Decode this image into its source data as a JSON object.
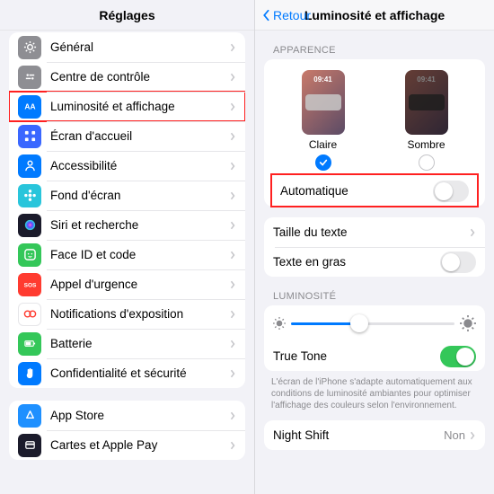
{
  "left": {
    "title": "Réglages",
    "items": [
      {
        "label": "Général",
        "icon": "gear",
        "color": "#8e8e93"
      },
      {
        "label": "Centre de contrôle",
        "icon": "control",
        "color": "#8e8e93"
      },
      {
        "label": "Luminosité et affichage",
        "icon": "aa",
        "color": "#007aff",
        "highlight": true
      },
      {
        "label": "Écran d'accueil",
        "icon": "grid",
        "color": "#3a67ff"
      },
      {
        "label": "Accessibilité",
        "icon": "person",
        "color": "#007aff"
      },
      {
        "label": "Fond d'écran",
        "icon": "flower",
        "color": "#29c5db"
      },
      {
        "label": "Siri et recherche",
        "icon": "siri",
        "color": "#1b1b2b"
      },
      {
        "label": "Face ID et code",
        "icon": "face",
        "color": "#34c759"
      },
      {
        "label": "Appel d'urgence",
        "icon": "sos",
        "color": "#ff3b30"
      },
      {
        "label": "Notifications d'exposition",
        "icon": "exposure",
        "color": "#ffffff",
        "border": true
      },
      {
        "label": "Batterie",
        "icon": "battery",
        "color": "#34c759"
      },
      {
        "label": "Confidentialité et sécurité",
        "icon": "hand",
        "color": "#007aff"
      }
    ],
    "items2": [
      {
        "label": "App Store",
        "icon": "appstore",
        "color": "#1e90ff"
      },
      {
        "label": "Cartes et Apple Pay",
        "icon": "wallet",
        "color": "#1b1b2b"
      }
    ]
  },
  "right": {
    "back": "Retour",
    "title": "Luminosité et affichage",
    "appearance_header": "APPARENCE",
    "phone_time": "09:41",
    "light_label": "Claire",
    "dark_label": "Sombre",
    "selected": "light",
    "auto_label": "Automatique",
    "auto_on": false,
    "text_size": "Taille du texte",
    "bold_text": "Texte en gras",
    "bold_on": false,
    "brightness_header": "LUMINOSITÉ",
    "truetone_label": "True Tone",
    "truetone_on": true,
    "truetone_note": "L'écran de l'iPhone s'adapte automatiquement aux conditions de luminosité ambiantes pour optimiser l'affichage des couleurs selon l'environnement.",
    "nightshift_label": "Night Shift",
    "nightshift_value": "Non"
  }
}
